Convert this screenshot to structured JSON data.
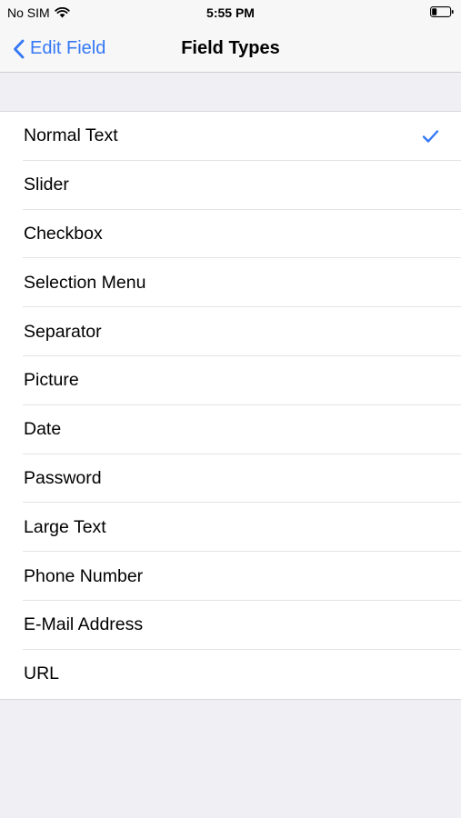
{
  "status_bar": {
    "carrier": "No SIM",
    "time": "5:55 PM"
  },
  "nav": {
    "back_label": "Edit Field",
    "title": "Field Types"
  },
  "field_types": [
    {
      "label": "Normal Text",
      "selected": true
    },
    {
      "label": "Slider",
      "selected": false
    },
    {
      "label": "Checkbox",
      "selected": false
    },
    {
      "label": "Selection Menu",
      "selected": false
    },
    {
      "label": "Separator",
      "selected": false
    },
    {
      "label": "Picture",
      "selected": false
    },
    {
      "label": "Date",
      "selected": false
    },
    {
      "label": "Password",
      "selected": false
    },
    {
      "label": "Large Text",
      "selected": false
    },
    {
      "label": "Phone Number",
      "selected": false
    },
    {
      "label": "E-Mail Address",
      "selected": false
    },
    {
      "label": "URL",
      "selected": false
    }
  ],
  "colors": {
    "accent": "#3478f6",
    "background": "#efeff4"
  },
  "icons": {
    "wifi": "wifi-icon",
    "battery": "battery-icon",
    "back": "chevron-left-icon",
    "selected": "checkmark-icon"
  }
}
